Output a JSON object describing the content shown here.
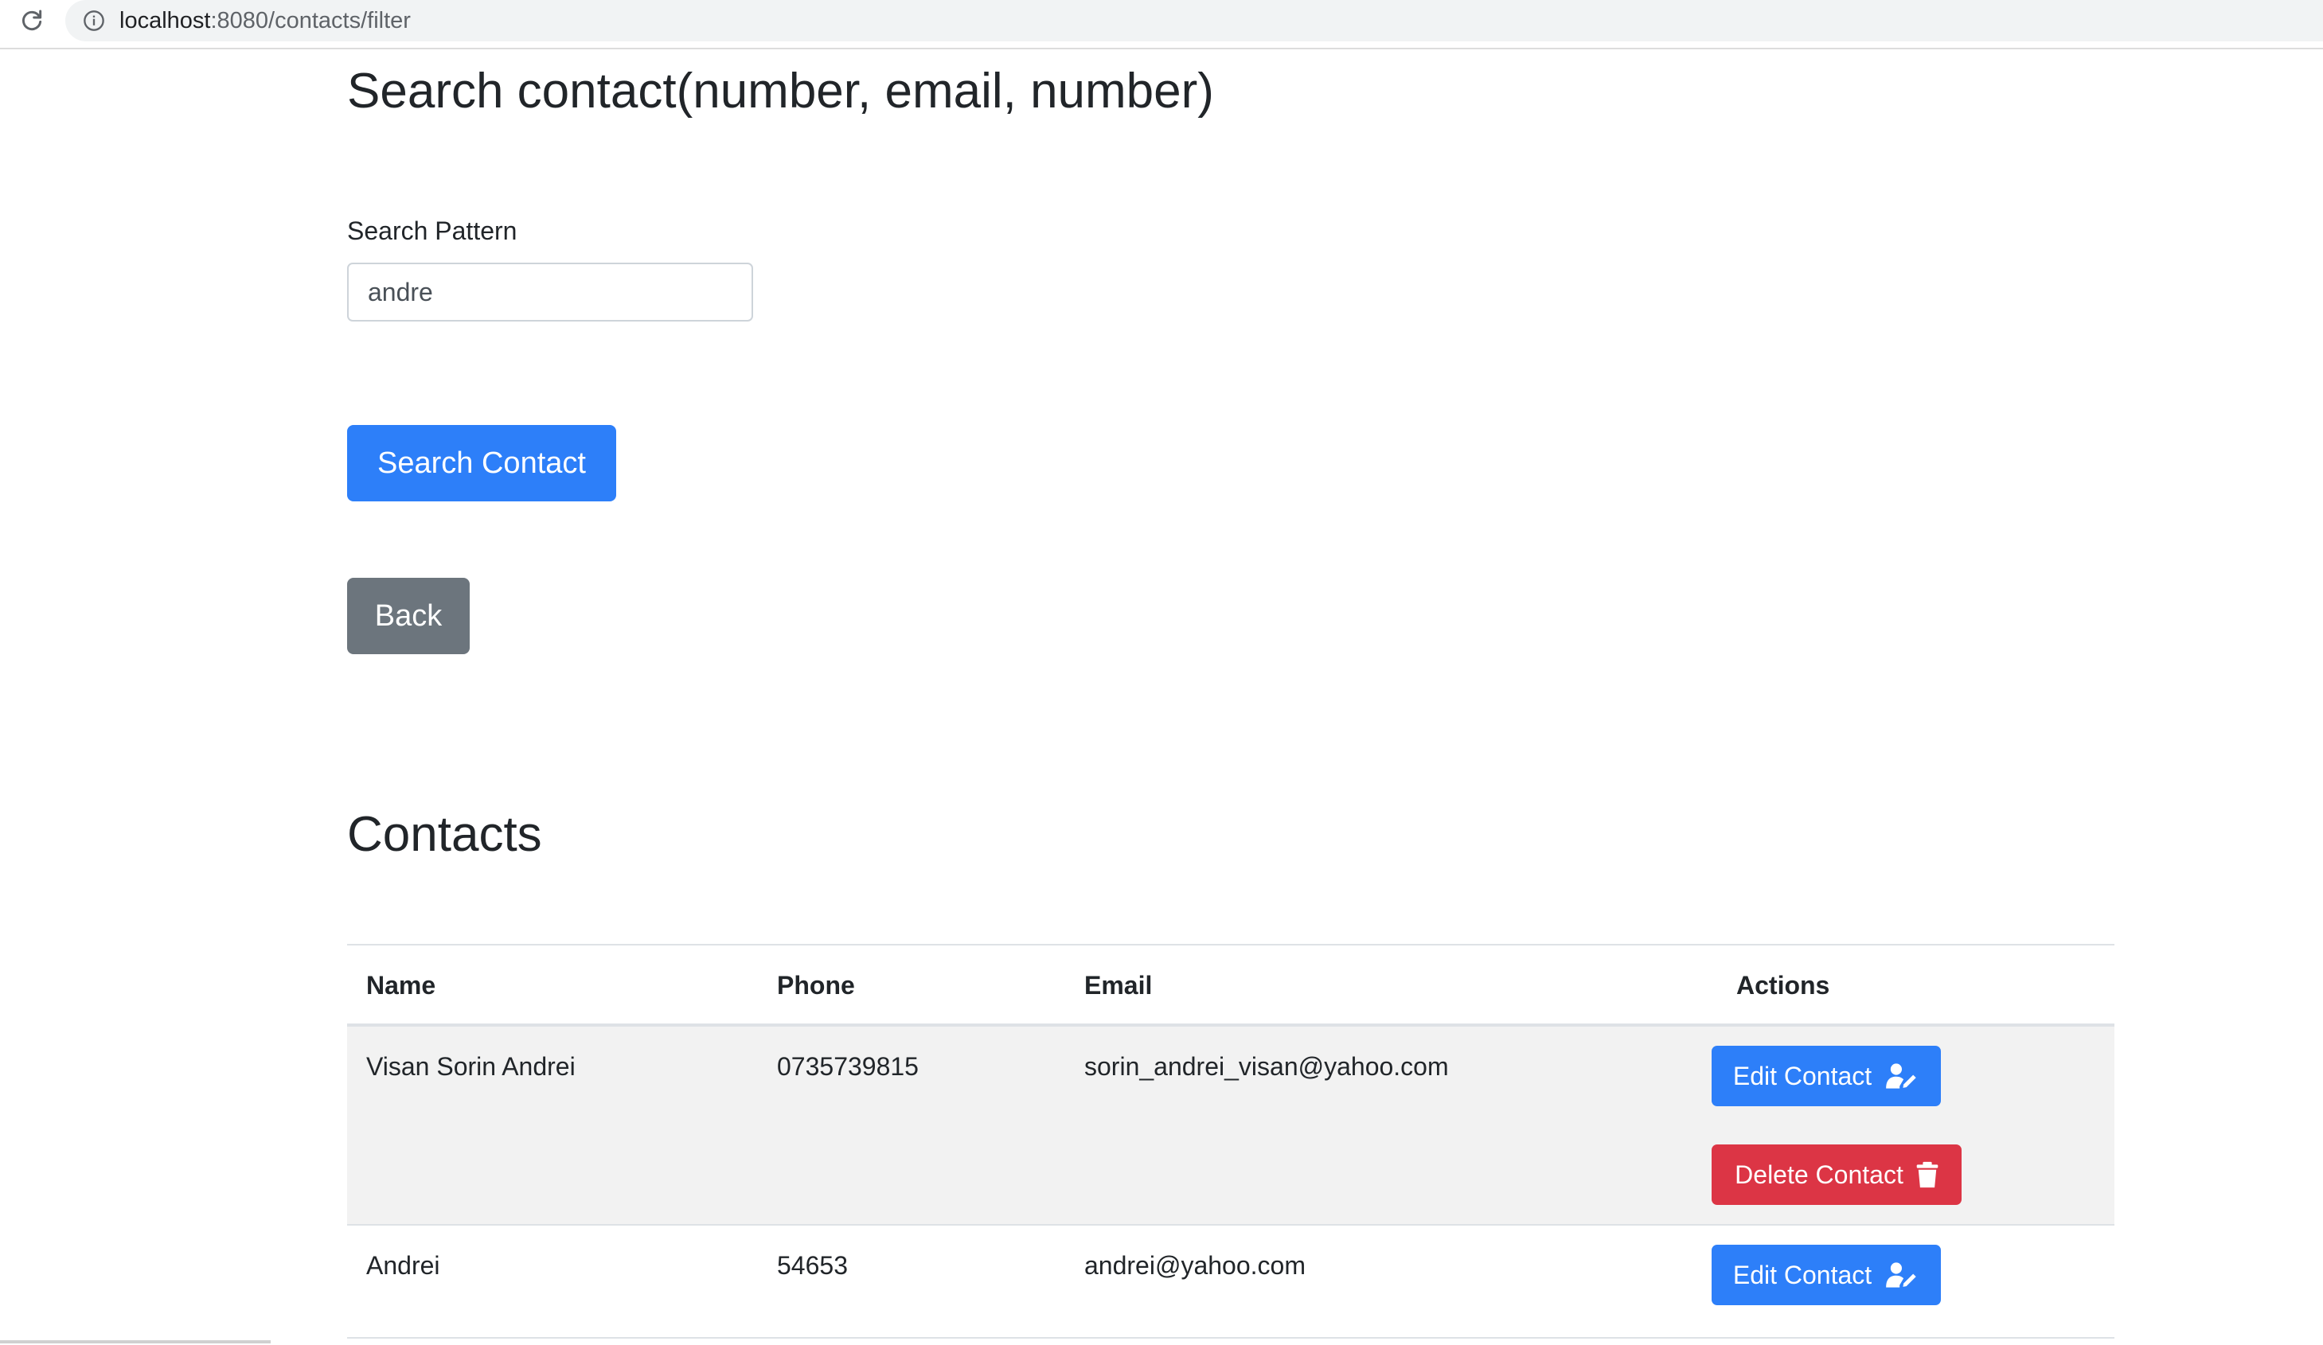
{
  "browser": {
    "url_host": "localhost",
    "url_path": ":8080/contacts/filter"
  },
  "page": {
    "title": "Search contact(number, email, number)"
  },
  "search": {
    "label": "Search Pattern",
    "value": "andre"
  },
  "buttons": {
    "search": "Search Contact",
    "back": "Back"
  },
  "contacts": {
    "heading": "Contacts",
    "columns": [
      "Name",
      "Phone",
      "Email",
      "Actions"
    ],
    "rows": [
      {
        "name": "Visan Sorin Andrei",
        "phone": "0735739815",
        "email": "sorin_andrei_visan@yahoo.com",
        "edit_label": "Edit Contact",
        "delete_label": "Delete Contact"
      },
      {
        "name": "Andrei",
        "phone": "54653",
        "email": "andrei@yahoo.com",
        "edit_label": "Edit Contact"
      }
    ]
  },
  "icons": {
    "reload": "reload-icon",
    "info": "info-icon",
    "edit": "user-edit-icon",
    "delete": "trash-icon"
  },
  "colors": {
    "primary": "#2d7ff9",
    "secondary": "#6c757d",
    "danger": "#dc3545",
    "stripe": "#f2f2f2"
  }
}
